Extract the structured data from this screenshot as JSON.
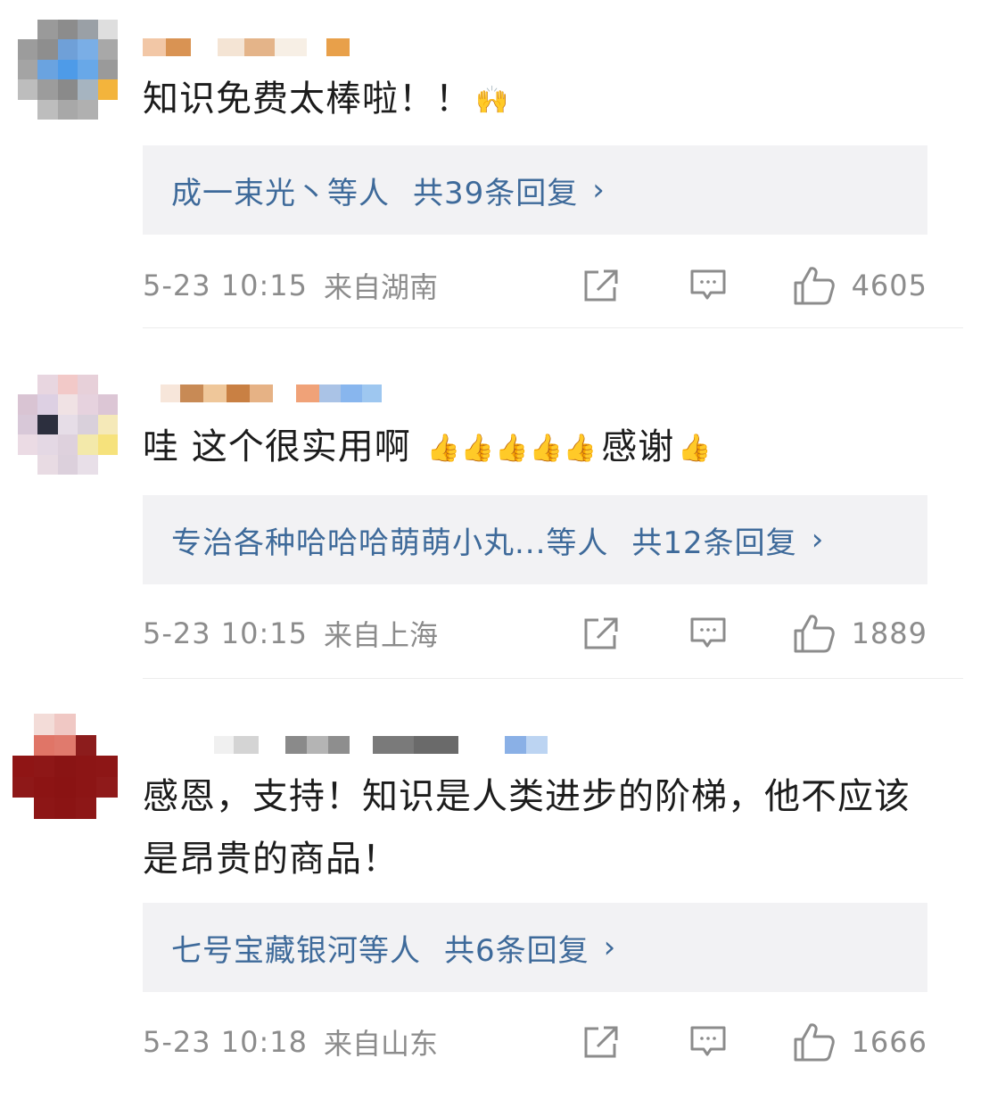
{
  "comments": [
    {
      "text": "知识免费太棒啦！！",
      "emoji": "🙌",
      "reply_preview": "成一束光丶等人",
      "reply_count": "共39条回复",
      "time": "5-23 10:15",
      "location": "来自湖南",
      "likes": "4605"
    },
    {
      "text": "哇 这个很实用啊",
      "emoji_seq": "👍👍👍👍👍",
      "text_after": "感谢",
      "emoji_end": "👍",
      "reply_preview": "专治各种哈哈哈萌萌小丸...等人",
      "reply_count": "共12条回复",
      "time": "5-23 10:15",
      "location": "来自上海",
      "likes": "1889"
    },
    {
      "text": "感恩，支持！知识是人类进步的阶梯，他不应该是昂贵的商品！",
      "reply_preview": "七号宝藏银河等人",
      "reply_count": "共6条回复",
      "time": "5-23 10:18",
      "location": "来自山东",
      "likes": "1666"
    }
  ],
  "icons": {
    "share": "share-icon",
    "comment": "comment-icon",
    "like": "thumbs-up-icon",
    "chevron": "›"
  },
  "colors": {
    "link": "#3e6a9a",
    "meta": "#8c8c8c",
    "reply_bg": "#f2f2f4"
  }
}
